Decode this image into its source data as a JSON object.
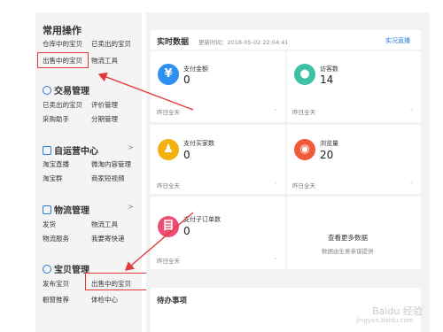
{
  "sidebar": {
    "common_ops_title": "常用操作",
    "common_ops_row1": [
      "仓库中的宝贝",
      "已卖出的宝贝"
    ],
    "common_ops_row2": [
      "出售中的宝贝",
      "物流工具"
    ],
    "trade_title": "交易管理",
    "trade_row1": [
      "已卖出的宝贝",
      "评价管理"
    ],
    "trade_row2": [
      "采购助手",
      "分期管理"
    ],
    "self_center_title": "自运营中心",
    "self_center_row1": [
      "淘宝直播",
      "微淘内容管理"
    ],
    "self_center_row2": [
      "淘宝群",
      "商家短视频"
    ],
    "logistics_title": "物流管理",
    "logistics_row1": [
      "发货",
      "物流工具"
    ],
    "logistics_row2": [
      "物流服务",
      "我要寄快递"
    ],
    "goods_title": "宝贝管理",
    "goods_row1": [
      "发布宝贝",
      "出售中的宝贝"
    ],
    "goods_row2": [
      "橱窗推荐",
      "体检中心"
    ],
    "chevron": ">"
  },
  "realtime": {
    "title": "实时数据",
    "update_time": "更新时间：2018-05-02 22:04:41",
    "live_link": "实况直播"
  },
  "metrics": [
    {
      "label": "支付金额",
      "value": "0",
      "foot": "昨日全天",
      "icon": "yen-icon",
      "color": "#2f8fef",
      "glyph": "¥"
    },
    {
      "label": "访客数",
      "value": "14",
      "foot": "昨日全天",
      "icon": "footprint-icon",
      "color": "#3cc1a4",
      "glyph": "●"
    },
    {
      "label": "支付买家数",
      "value": "0",
      "foot": "昨日全天",
      "icon": "buyers-icon",
      "color": "#f3b10f",
      "glyph": "♟"
    },
    {
      "label": "浏览量",
      "value": "20",
      "foot": "昨日全天",
      "icon": "eye-icon",
      "color": "#f25a3c",
      "glyph": "◉"
    },
    {
      "label": "支付子订单数",
      "value": "0",
      "foot": "昨日全天",
      "icon": "order-icon",
      "color": "#ea4f74",
      "glyph": "目"
    }
  ],
  "more": {
    "title": "查看更多数据",
    "subtitle": "数据由生意参谋提供"
  },
  "todo": {
    "title": "待办事项"
  },
  "dash": "-",
  "watermark": {
    "line1": "Baidu 经验",
    "line2": "jingyan.baidu.com"
  },
  "colors": {
    "highlight": "#e4393c",
    "accent": "#2b7bd7"
  }
}
